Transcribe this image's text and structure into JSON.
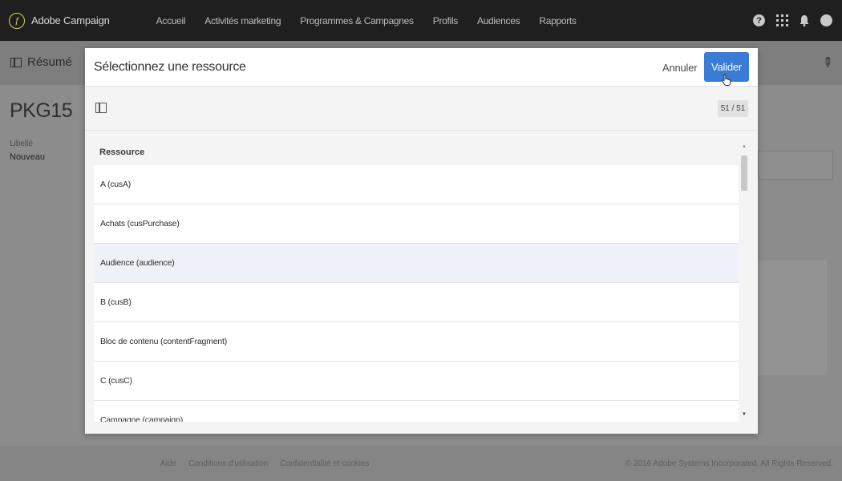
{
  "app": {
    "name": "Adobe Campaign"
  },
  "nav": {
    "items": [
      {
        "label": "Accueil"
      },
      {
        "label": "Activités marketing"
      },
      {
        "label": "Programmes & Campagnes"
      },
      {
        "label": "Profils"
      },
      {
        "label": "Audiences"
      },
      {
        "label": "Rapports"
      }
    ]
  },
  "topbar": {
    "help_glyph": "?",
    "icons": [
      "help-icon",
      "apps-grid-icon",
      "bell-icon",
      "avatar"
    ]
  },
  "background_page": {
    "section": "Résumé",
    "title": "PKG15",
    "label_field": {
      "label": "Libellé",
      "value": "Nouveau"
    }
  },
  "modal": {
    "title": "Sélectionnez une ressource",
    "cancel_label": "Annuler",
    "validate_label": "Valider",
    "count": "51 / 51",
    "column_header": "Ressource",
    "rows": [
      {
        "label": "A (cusA)"
      },
      {
        "label": "Achats (cusPurchase)"
      },
      {
        "label": "Audience (audience)",
        "selected": true
      },
      {
        "label": "B (cusB)"
      },
      {
        "label": "Bloc de contenu (contentFragment)"
      },
      {
        "label": "C (cusC)"
      },
      {
        "label": "Campagne (campaign)"
      }
    ]
  },
  "footer": {
    "links": [
      "Aide",
      "Conditions d'utilisation",
      "Confidentialité et cookies"
    ],
    "copyright": "© 2016 Adobe Systems Incorporated. All Rights Reserved."
  },
  "colors": {
    "topbar": "#1f1f1f",
    "primary_button": "#3a7bd5",
    "selected_row": "#eef2f8",
    "logo": "#d8d35a"
  }
}
